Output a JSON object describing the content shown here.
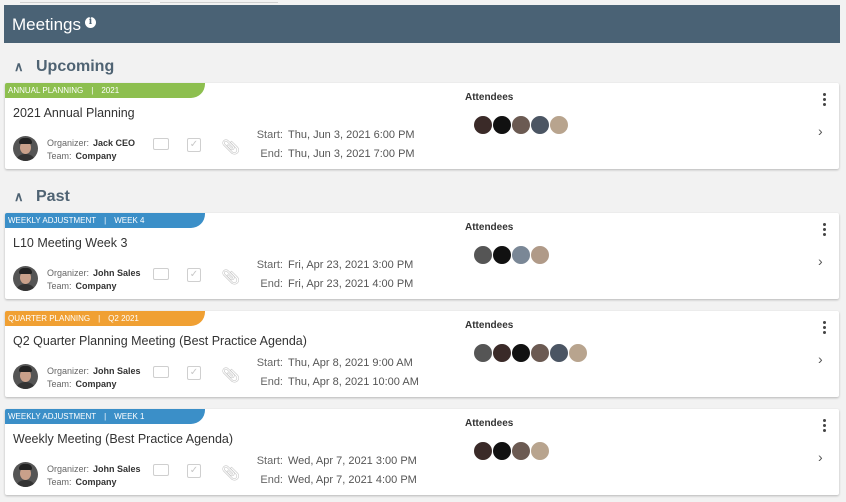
{
  "header": {
    "title": "Meetings",
    "info_icon": "info-circle-icon"
  },
  "sections": {
    "upcoming": "Upcoming",
    "past": "Past"
  },
  "labels": {
    "organizer": "Organizer:",
    "team": "Team:",
    "start": "Start:",
    "end": "End:",
    "attendees": "Attendees"
  },
  "colors": {
    "header_bg": "#4a6275",
    "tag_annual": "#8dbf4f",
    "tag_weekly": "#3b8fc8",
    "tag_quarter": "#f0a033"
  },
  "meetings": [
    {
      "tag_left": "ANNUAL PLANNING",
      "tag_right": "2021",
      "title": "2021 Annual Planning",
      "organizer": "Jack CEO",
      "team": "Company",
      "start": "Thu, Jun 3, 2021 6:00 PM",
      "end": "Thu, Jun 3, 2021 7:00 PM",
      "attendee_count": 5
    },
    {
      "tag_left": "WEEKLY ADJUSTMENT",
      "tag_right": "WEEK 4",
      "title": "L10 Meeting Week 3",
      "organizer": "John Sales",
      "team": "Company",
      "start": "Fri, Apr 23, 2021 3:00 PM",
      "end": "Fri, Apr 23, 2021 4:00 PM",
      "attendee_count": 4
    },
    {
      "tag_left": "QUARTER PLANNING",
      "tag_right": "Q2 2021",
      "title": "Q2 Quarter Planning Meeting (Best Practice Agenda)",
      "organizer": "John Sales",
      "team": "Company",
      "start": "Thu, Apr 8, 2021 9:00 AM",
      "end": "Thu, Apr 8, 2021 10:00 AM",
      "attendee_count": 6
    },
    {
      "tag_left": "WEEKLY ADJUSTMENT",
      "tag_right": "WEEK 1",
      "title": "Weekly Meeting (Best Practice Agenda)",
      "organizer": "John Sales",
      "team": "Company",
      "start": "Wed, Apr 7, 2021 3:00 PM",
      "end": "Wed, Apr 7, 2021 4:00 PM",
      "attendee_count": 4
    }
  ]
}
